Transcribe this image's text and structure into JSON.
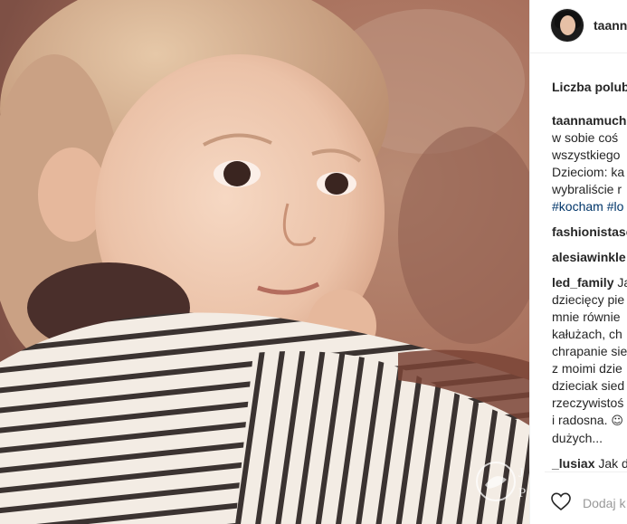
{
  "post": {
    "username": "taannamuch",
    "likes_label": "Liczba polub",
    "add_comment_placeholder": "Dodaj k"
  },
  "photo": {
    "watermark_text": "J\nP"
  },
  "comments": [
    {
      "user": "taannamuch",
      "lines": [
        "w sobie coś",
        "wszystkiego",
        "Dzieciom: ka",
        "wybraliście r"
      ],
      "hashtags": "#kocham #lo"
    },
    {
      "user": "fashionistasc",
      "lines": []
    },
    {
      "user": "alesiawinkle",
      "lines": []
    },
    {
      "user": "led_family",
      "first_text": " Ja",
      "lines": [
        "dziecięcy pie",
        "mnie równie",
        "kałużach, ch",
        "chrapanie sie",
        "z moimi dzie",
        "dzieciak sied",
        "rzeczywistoś"
      ],
      "last_line_text": "i radosna. ",
      "emoji": "☺",
      "extra_line": "dużych..."
    },
    {
      "user": "_lusiax",
      "first_text": " Jak d",
      "lines": []
    }
  ],
  "colors": {
    "hashtag": "#003569",
    "border": "#efefef",
    "muted": "#999999",
    "text": "#262626"
  },
  "icons": {
    "heart": "heart-outline-icon"
  }
}
